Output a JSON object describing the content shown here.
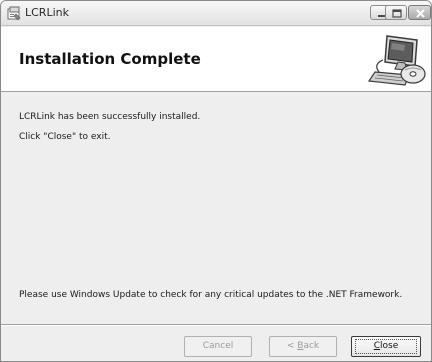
{
  "window": {
    "title": "LCRLink",
    "icons": [
      "installer-app-icon",
      "minimize-icon",
      "maximize-icon",
      "close-icon"
    ]
  },
  "header": {
    "title": "Installation Complete",
    "graphic": "computer-cd-icon"
  },
  "body": {
    "line_1": "LCRLink has been successfully installed.",
    "line_2": "Click \"Close\" to exit.",
    "line_3": "Please use Windows Update to check for any critical updates to the .NET Framework."
  },
  "buttons": {
    "cancel_label": "Cancel",
    "back_prefix": "< ",
    "back_accel": "B",
    "back_rest": "ack",
    "close_accel": "C",
    "close_rest": "lose",
    "cancel_enabled": false,
    "back_enabled": false,
    "close_enabled": true
  },
  "colors": {
    "window_bg": "#eeeeee",
    "header_bg": "#ffffff",
    "disabled_text": "#9a9a9a",
    "close_red": "#c8443a"
  }
}
